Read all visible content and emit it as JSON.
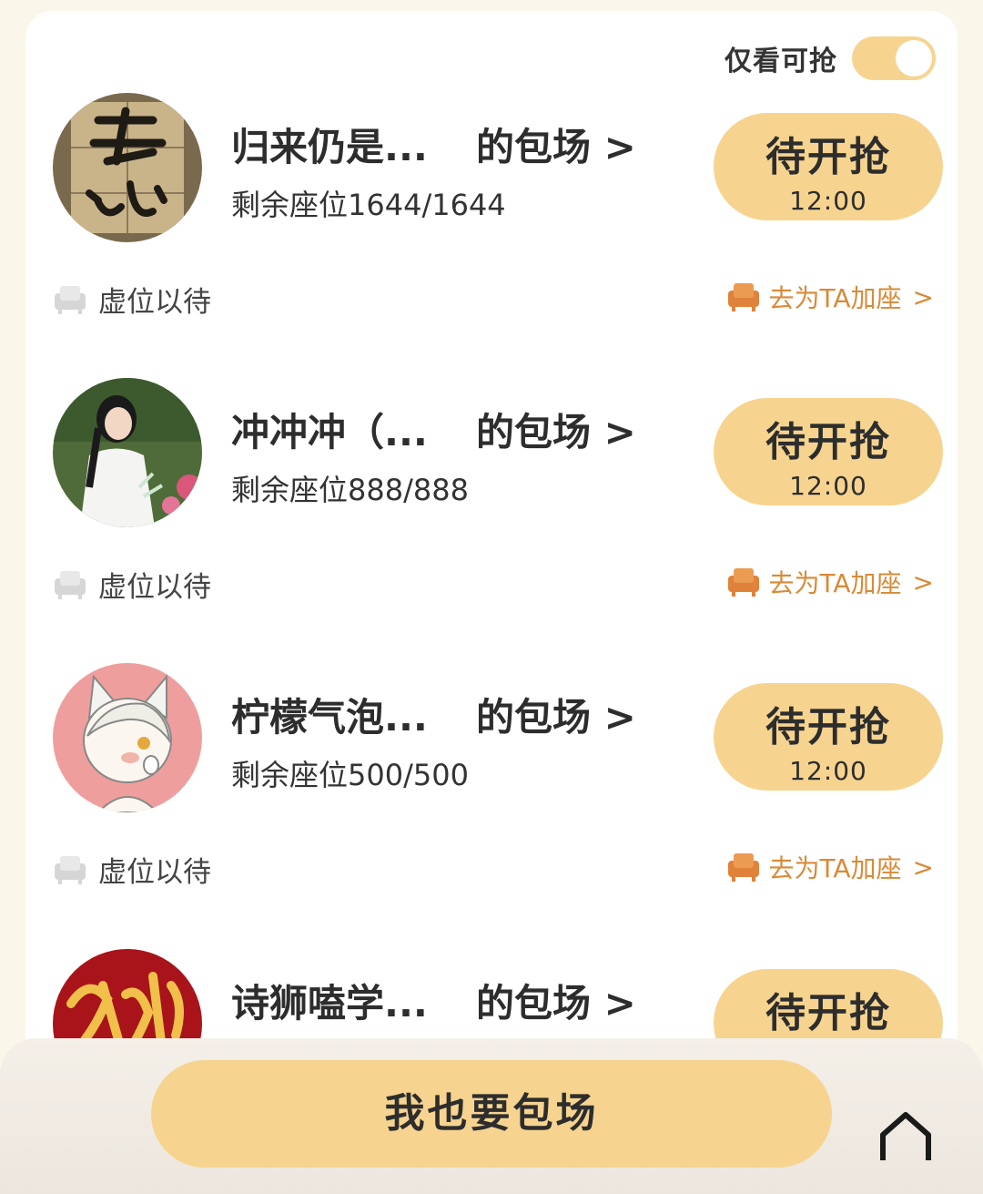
{
  "filter": {
    "label": "仅看可抢",
    "on": true
  },
  "listings": [
    {
      "name": "归来仍是...",
      "suffix": "的包场 >",
      "seats": "剩余座位1644/1644",
      "button_title": "待开抢",
      "button_time": "12:00",
      "left_label": "虚位以待",
      "right_label": "去为TA加座",
      "chevron": ">"
    },
    {
      "name": "冲冲冲（...",
      "suffix": "的包场 >",
      "seats": "剩余座位888/888",
      "button_title": "待开抢",
      "button_time": "12:00",
      "left_label": "虚位以待",
      "right_label": "去为TA加座",
      "chevron": ">"
    },
    {
      "name": "柠檬气泡...",
      "suffix": "的包场 >",
      "seats": "剩余座位500/500",
      "button_title": "待开抢",
      "button_time": "12:00",
      "left_label": "虚位以待",
      "right_label": "去为TA加座",
      "chevron": ">"
    },
    {
      "name": "诗狮嗑学...",
      "suffix": "的包场 >",
      "button_title": "待开抢"
    }
  ],
  "cta_label": "我也要包场",
  "icons": {
    "seat": "armchair-icon",
    "home": "home-icon"
  },
  "colors": {
    "accent": "#f6d490",
    "link": "#d98a37",
    "background": "#fbf6ea"
  }
}
